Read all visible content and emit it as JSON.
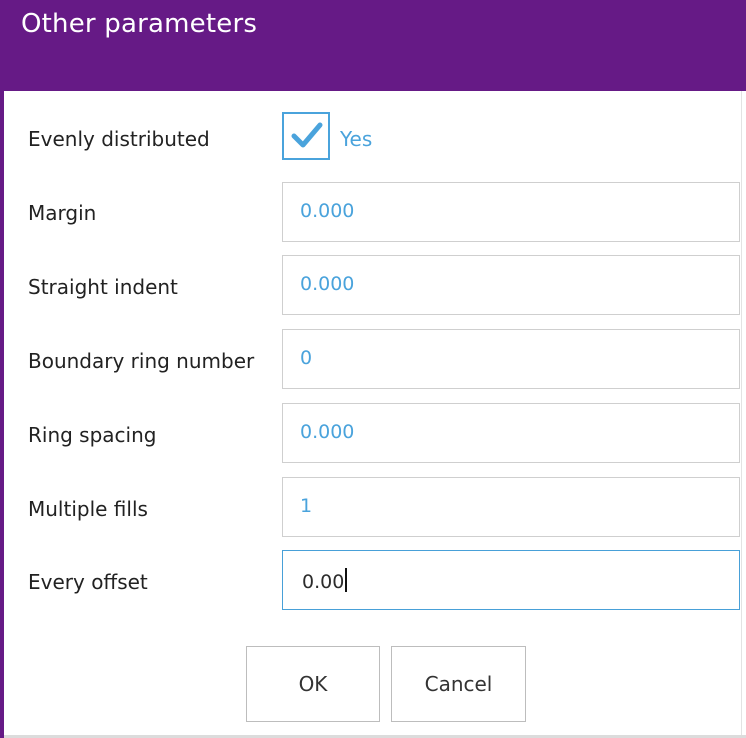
{
  "dialog": {
    "title": "Other parameters",
    "accent_color": "#661a86",
    "value_color": "#4aa3dc"
  },
  "fields": {
    "evenly_distributed": {
      "label": "Evenly distributed",
      "checked": true,
      "check_text": "Yes"
    },
    "margin": {
      "label": "Margin",
      "value": "0.000"
    },
    "straight_indent": {
      "label": "Straight indent",
      "value": "0.000"
    },
    "boundary_ring_number": {
      "label": "Boundary ring number",
      "value": "0"
    },
    "ring_spacing": {
      "label": "Ring spacing",
      "value": "0.000"
    },
    "multiple_fills": {
      "label": "Multiple fills",
      "value": "1"
    },
    "every_offset": {
      "label": "Every offset",
      "value": "0.00",
      "focused": true
    }
  },
  "buttons": {
    "ok": "OK",
    "cancel": "Cancel"
  },
  "icons": {
    "checkbox": "check-icon"
  }
}
